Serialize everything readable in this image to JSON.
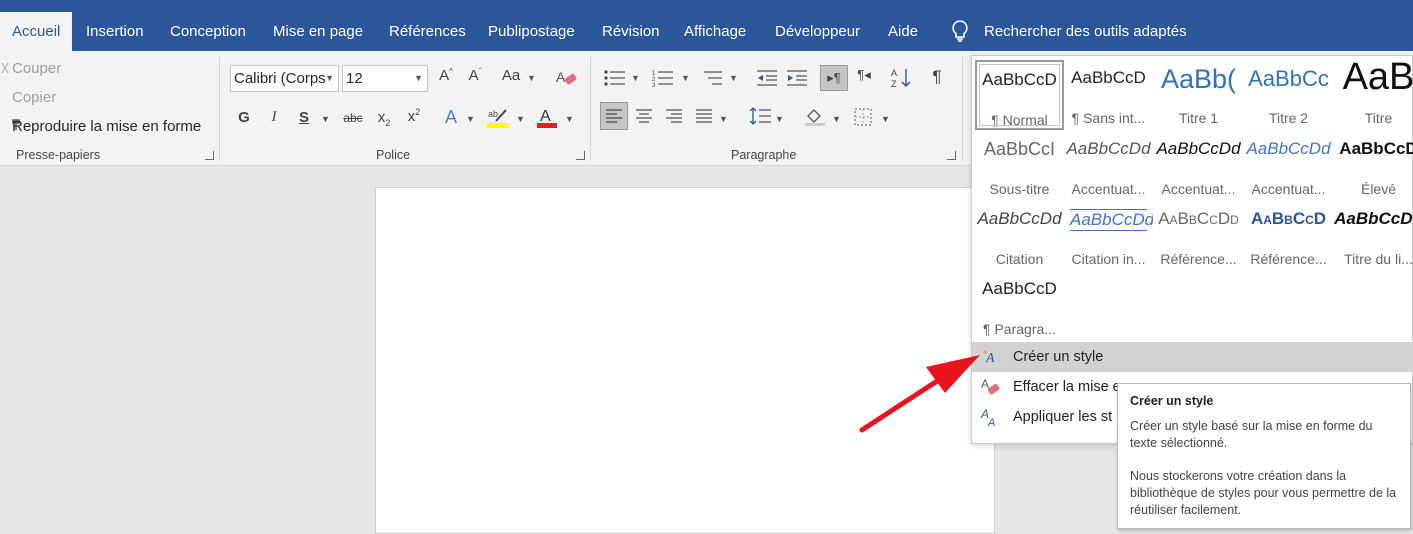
{
  "tabs": [
    "Accueil",
    "Insertion",
    "Conception",
    "Mise en page",
    "Références",
    "Publipostage",
    "Révision",
    "Affichage",
    "Développeur",
    "Aide"
  ],
  "active_tab": "Accueil",
  "search_label": "Rechercher des outils adaptés",
  "clipboard": {
    "cut": "Couper",
    "copy": "Copier",
    "format_painter": "Reproduire la mise en forme",
    "label": "Presse-papiers"
  },
  "font": {
    "name": "Calibri (Corps",
    "size": "12",
    "label": "Police",
    "bold": "G",
    "italic": "I",
    "underline": "S",
    "strike": "abc",
    "font_color": "#e02020",
    "highlight_color": "#ffff00"
  },
  "paragraph": {
    "label": "Paragraphe"
  },
  "styles": [
    {
      "preview": "AaBbCcD",
      "name": "¶ Normal",
      "selected": true
    },
    {
      "preview": "AaBbCcD",
      "name": "¶ Sans int..."
    },
    {
      "preview": "AaBb(",
      "name": "Titre 1"
    },
    {
      "preview": "AaBbCc",
      "name": "Titre 2"
    },
    {
      "preview": "AaB",
      "name": "Titre"
    },
    {
      "preview": "AaBbCcI",
      "name": "Sous-titre"
    },
    {
      "preview": "AaBbCcDd",
      "name": "Accentuat..."
    },
    {
      "preview": "AaBbCcDd",
      "name": "Accentuat..."
    },
    {
      "preview": "AaBbCcDd",
      "name": "Accentuat..."
    },
    {
      "preview": "AaBbCcD",
      "name": "Élevé"
    },
    {
      "preview": "AaBbCcDd",
      "name": "Citation"
    },
    {
      "preview": "AaBbCcDd",
      "name": "Citation in..."
    },
    {
      "preview": "AaBbCcDd",
      "name": "Référence..."
    },
    {
      "preview": "AaBbCcD",
      "name": "Référence..."
    },
    {
      "preview": "AaBbCcDd",
      "name": "Titre du li..."
    },
    {
      "preview": "AaBbCcD",
      "name": "¶ Paragra..."
    }
  ],
  "menu": {
    "create": "Créer un style",
    "clear": "Effacer la mise e",
    "apply": "Appliquer les st"
  },
  "tooltip": {
    "title": "Créer un style",
    "p1": "Créer un style basé sur la mise en forme du texte sélectionné.",
    "p2": "Nous stockerons votre création dans la bibliothèque de styles pour vous permettre de la réutiliser facilement."
  },
  "colors": {
    "ribbon_blue": "#2b579a",
    "annotation_arrow": "#e8141c"
  }
}
